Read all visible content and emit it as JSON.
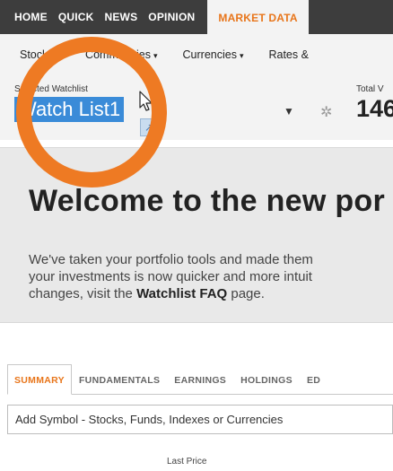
{
  "topnav": {
    "items": [
      "HOME",
      "QUICK",
      "NEWS",
      "OPINION",
      "MARKET DATA"
    ],
    "active_index": 4
  },
  "subnav": {
    "items": [
      {
        "label": "Stocks",
        "caret": "▾"
      },
      {
        "label": "Commodities",
        "caret": "▾"
      },
      {
        "label": "Currencies",
        "caret": "▾"
      },
      {
        "label": "Rates &",
        "caret": ""
      }
    ]
  },
  "watchlist": {
    "label": "Selected Watchlist",
    "selected": "Watch List1",
    "total_label": "Total V",
    "total_value": "146"
  },
  "welcome": {
    "title": "Welcome to the new por",
    "line1": "We've taken your portfolio tools and made them",
    "line2": "your investments is now quicker and more intuit",
    "line3_pre": "changes, visit the ",
    "line3_bold": "Watchlist FAQ",
    "line3_post": " page."
  },
  "tabs": [
    "SUMMARY",
    "FUNDAMENTALS",
    "EARNINGS",
    "HOLDINGS",
    "ED"
  ],
  "add_symbol": "Add Symbol - Stocks, Funds, Indexes or Currencies",
  "columns": {
    "last_price": "Last Price"
  },
  "colors": {
    "accent": "#e8751a",
    "annotation": "#ee7a23",
    "selection": "#3a8bd8",
    "nav_bg": "#3d3d3d"
  },
  "icons": [
    "gear-icon",
    "mouse-cursor-icon",
    "external-link-icon"
  ]
}
